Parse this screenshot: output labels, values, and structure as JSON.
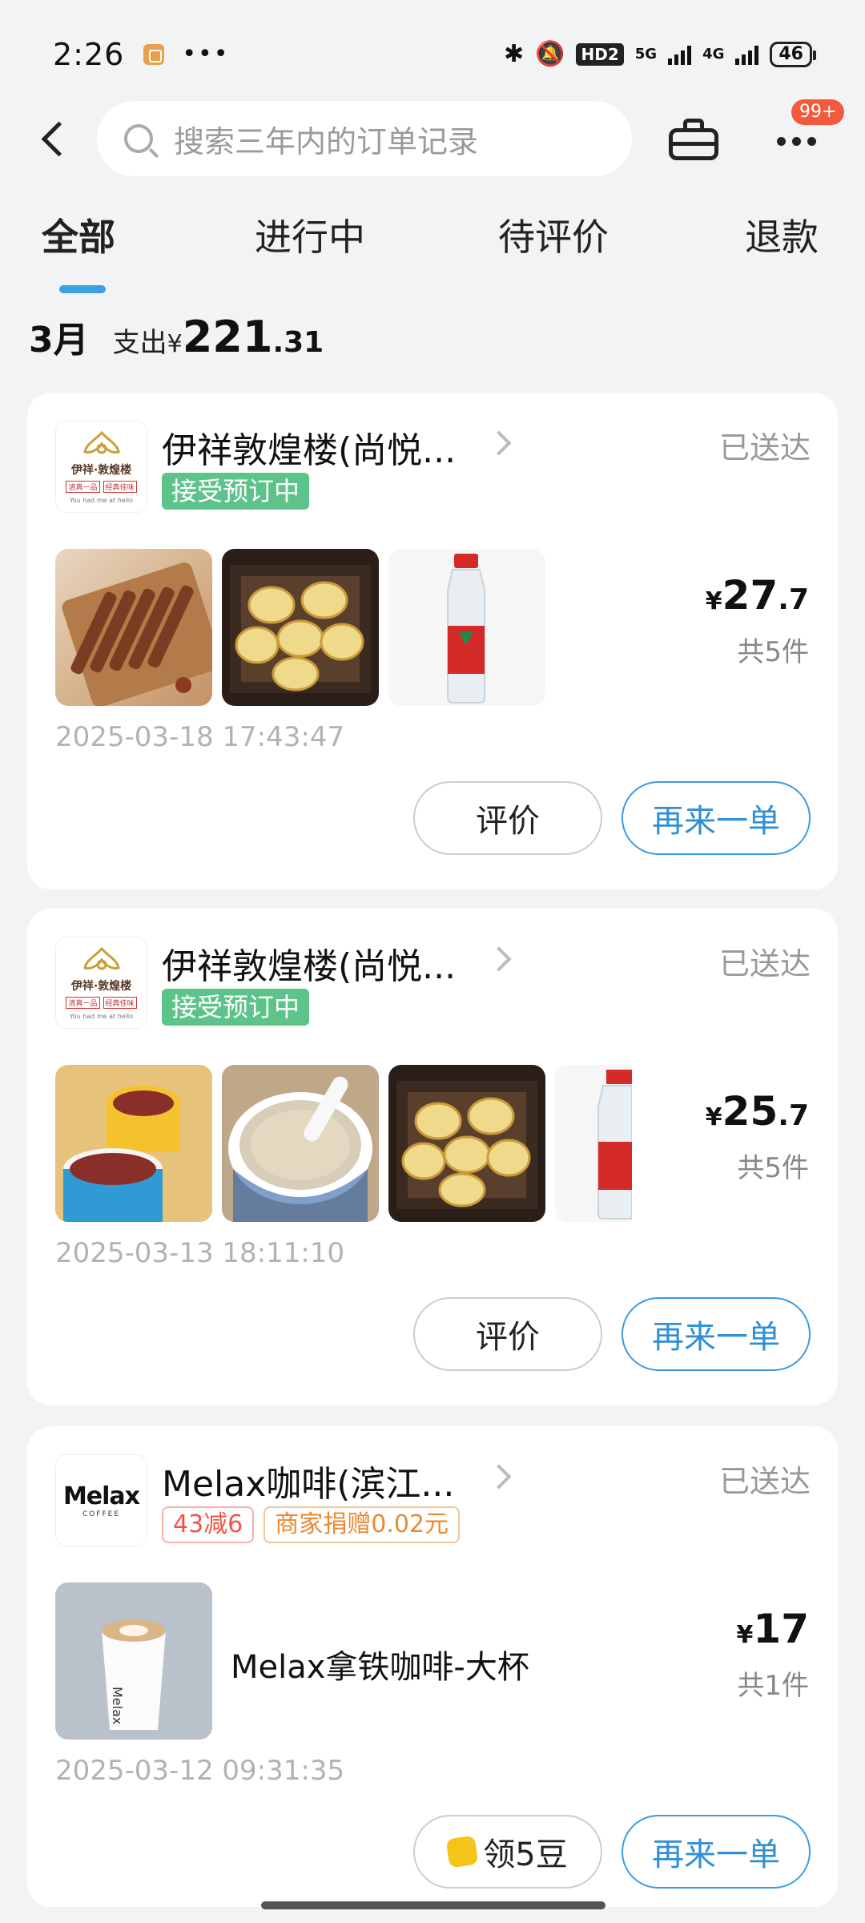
{
  "status_bar": {
    "time": "2:26",
    "dots": "•••",
    "hd": "HD2",
    "net1": "5G",
    "net2": "4G",
    "battery": "46"
  },
  "header": {
    "search_placeholder": "搜索三年内的订单记录",
    "badge": "99+"
  },
  "tabs": [
    "全部",
    "进行中",
    "待评价",
    "退款"
  ],
  "summary": {
    "month": "3月",
    "spend_label": "支出",
    "currency": "¥",
    "amount_int": "221",
    "amount_dec": ".31"
  },
  "orders": [
    {
      "shop_name": "伊祥敦煌楼(尚悦...",
      "status": "已送达",
      "tag": "接受预订中",
      "price_currency": "¥",
      "price_int": "27",
      "price_dec": ".7",
      "count": "共5件",
      "timestamp": "2025-03-18 17:43:47",
      "btn_left": "评价",
      "btn_right": "再来一单",
      "logo_text": "伊祥·敦煌楼",
      "logo_sub": [
        "清真一品",
        "经典佳味"
      ],
      "logo_eng": "You had me at hello"
    },
    {
      "shop_name": "伊祥敦煌楼(尚悦...",
      "status": "已送达",
      "tag": "接受预订中",
      "price_currency": "¥",
      "price_int": "25",
      "price_dec": ".7",
      "count": "共5件",
      "timestamp": "2025-03-13 18:11:10",
      "btn_left": "评价",
      "btn_right": "再来一单",
      "logo_text": "伊祥·敦煌楼",
      "logo_sub": [
        "清真一品",
        "经典佳味"
      ],
      "logo_eng": "You had me at hello"
    },
    {
      "shop_name": "Melax咖啡(滨江...",
      "status": "已送达",
      "tags": [
        "43减6",
        "商家捐赠0.02元"
      ],
      "product_name": "Melax拿铁咖啡-大杯",
      "price_currency": "¥",
      "price_int": "17",
      "count": "共1件",
      "timestamp": "2025-03-12 09:31:35",
      "btn_left": "领5豆",
      "btn_right": "再来一单",
      "logo_main": "Melax",
      "logo_sub": "COFFEE"
    }
  ],
  "colors": {
    "accent": "#3aa0e8",
    "tag_green": "#5cc48b",
    "badge_red": "#f3593d"
  }
}
